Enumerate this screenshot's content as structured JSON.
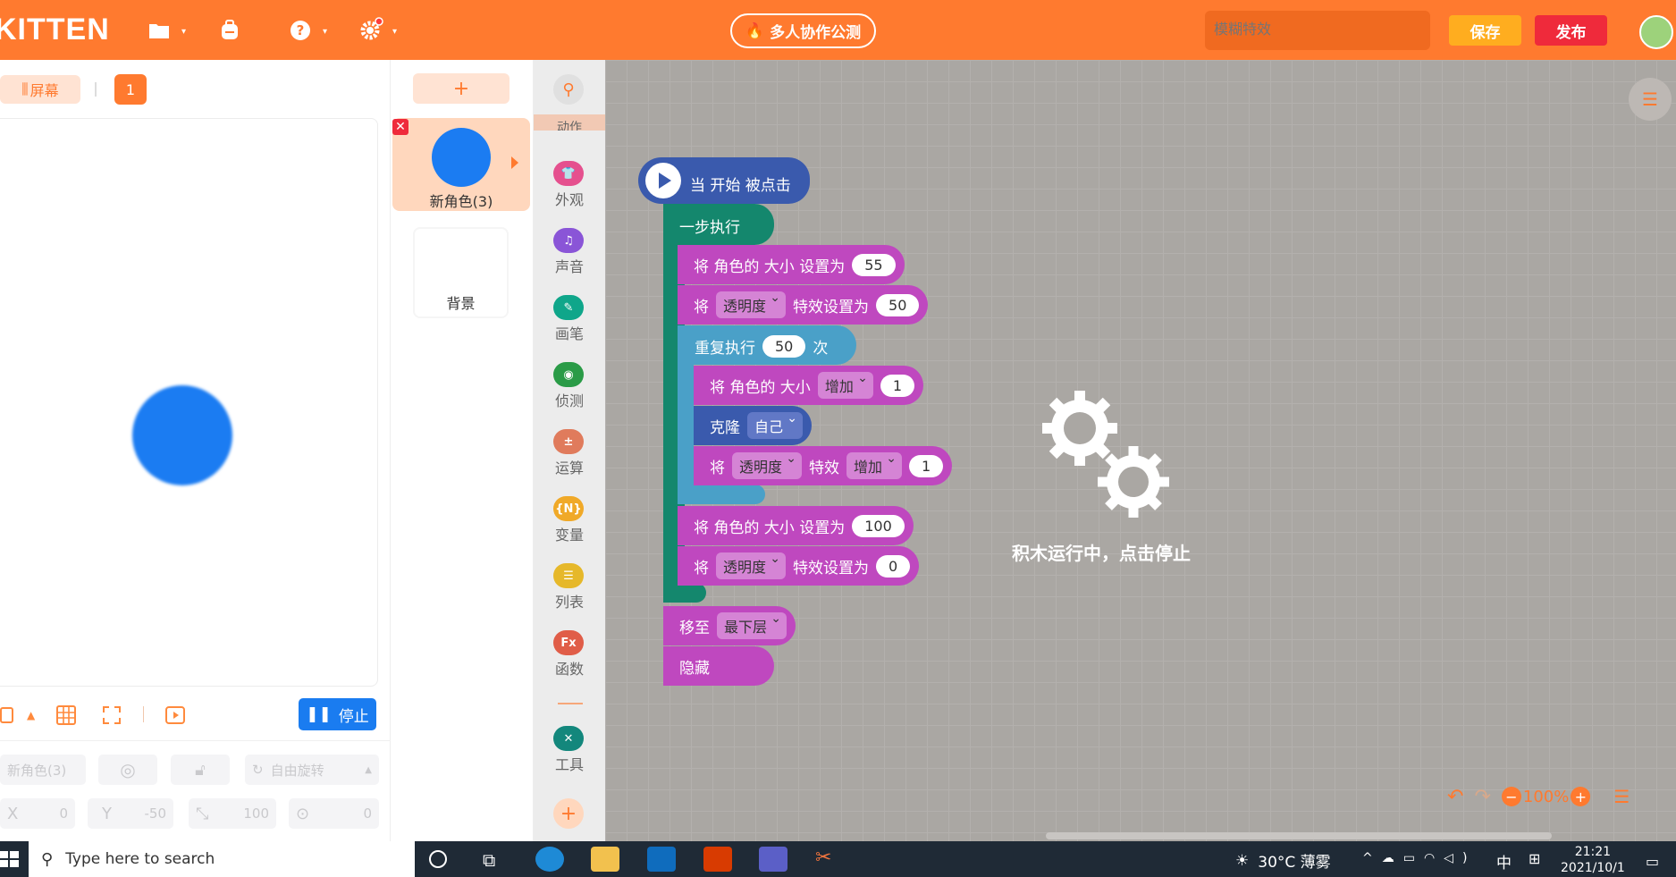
{
  "app": {
    "brand": "KITTEN",
    "collab_label": "多人协作公测",
    "search_placeholder": "模糊特效",
    "save_label": "保存",
    "publish_label": "发布"
  },
  "stage": {
    "screen_tab": "屏幕",
    "page_number": "1",
    "stop_label": "停止",
    "sprite_name_field": "新角色(3)",
    "rotation_label": "自由旋转",
    "x_label": "X",
    "x_value": "0",
    "y_label": "Y",
    "y_value": "-50",
    "size_value": "100",
    "direction_value": "0"
  },
  "sprites": {
    "add_label": "+",
    "current_sprite": "新角色(3)",
    "background_label": "背景"
  },
  "categories": [
    {
      "label": "动作",
      "color": "#4c97ff",
      "glyph": ""
    },
    {
      "label": "外观",
      "color": "#e5508e",
      "glyph": "👕"
    },
    {
      "label": "声音",
      "color": "#8a55d7",
      "glyph": "♫"
    },
    {
      "label": "画笔",
      "color": "#0fa68a",
      "glyph": "✎"
    },
    {
      "label": "侦测",
      "color": "#2a9b47",
      "glyph": "◉"
    },
    {
      "label": "运算",
      "color": "#e07b5c",
      "glyph": "±"
    },
    {
      "label": "变量",
      "color": "#f0a928",
      "glyph": "{N}"
    },
    {
      "label": "列表",
      "color": "#e6b82a",
      "glyph": "☰"
    },
    {
      "label": "函数",
      "color": "#e05d48",
      "glyph": "Fx"
    },
    {
      "label": "工具",
      "color": "#13877c",
      "glyph": "✕"
    }
  ],
  "blocks": {
    "hat": "当 开始 被点击",
    "atomic": "一步执行",
    "set_size_prefix": "将 角色的 大小 设置为",
    "set_size_value_1": "55",
    "effect_prefix": "将",
    "effect_name": "透明度",
    "effect_set": "特效设置为",
    "effect_value_1": "50",
    "repeat_label": "重复执行",
    "repeat_times": "50",
    "repeat_unit": "次",
    "change_size_prefix": "将 角色的 大小",
    "change_op": "增加",
    "change_size_value": "1",
    "clone_label": "克隆",
    "clone_target": "自己",
    "effect_change_label": "特效",
    "effect_change_value": "1",
    "set_size_value_2": "100",
    "effect_value_2": "0",
    "goto_label": "移至",
    "goto_layer": "最下层",
    "hide_label": "隐藏"
  },
  "workspace": {
    "running_text": "积木运行中，点击停止",
    "zoom": "100%"
  },
  "taskbar": {
    "search_placeholder": "Type here to search",
    "weather": "30°C 薄雾",
    "ime": "中",
    "time": "21:21",
    "date": "2021/10/1"
  }
}
